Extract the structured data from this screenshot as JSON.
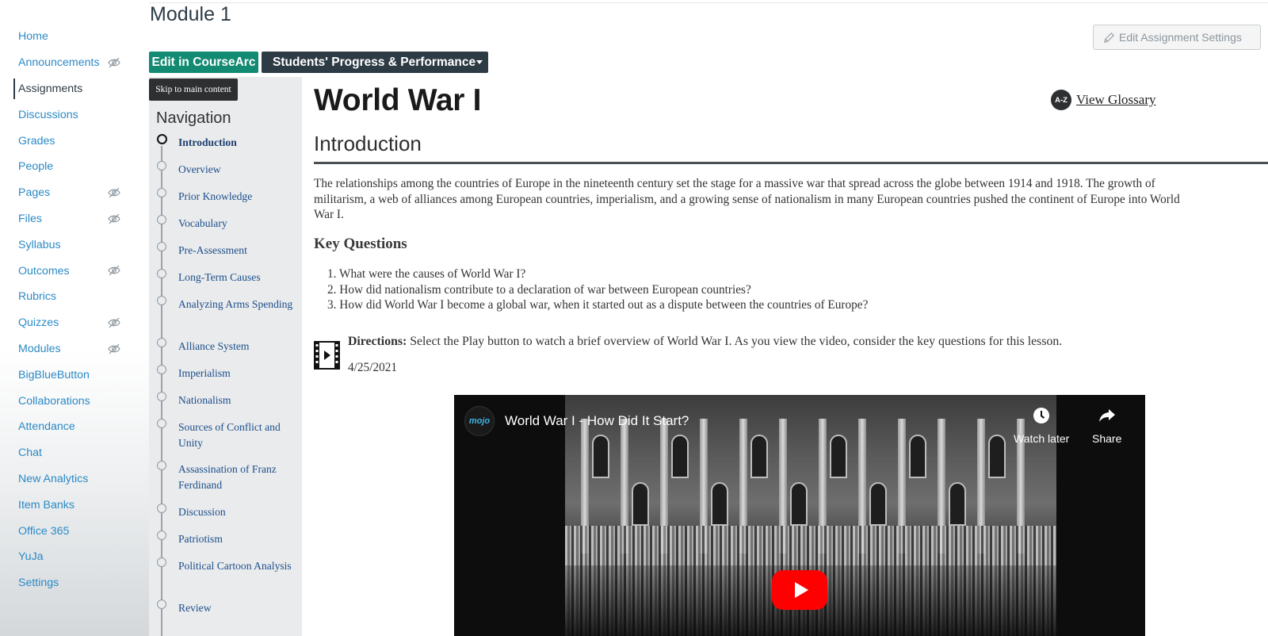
{
  "course_nav": {
    "items": [
      {
        "label": "Home",
        "hidden": false,
        "active": false
      },
      {
        "label": "Announcements",
        "hidden": true,
        "active": false
      },
      {
        "label": "Assignments",
        "hidden": false,
        "active": true
      },
      {
        "label": "Discussions",
        "hidden": false,
        "active": false
      },
      {
        "label": "Grades",
        "hidden": false,
        "active": false
      },
      {
        "label": "People",
        "hidden": false,
        "active": false
      },
      {
        "label": "Pages",
        "hidden": true,
        "active": false
      },
      {
        "label": "Files",
        "hidden": true,
        "active": false
      },
      {
        "label": "Syllabus",
        "hidden": false,
        "active": false
      },
      {
        "label": "Outcomes",
        "hidden": true,
        "active": false
      },
      {
        "label": "Rubrics",
        "hidden": false,
        "active": false
      },
      {
        "label": "Quizzes",
        "hidden": true,
        "active": false
      },
      {
        "label": "Modules",
        "hidden": true,
        "active": false
      },
      {
        "label": "BigBlueButton",
        "hidden": false,
        "active": false
      },
      {
        "label": "Collaborations",
        "hidden": false,
        "active": false
      },
      {
        "label": "Attendance",
        "hidden": false,
        "active": false
      },
      {
        "label": "Chat",
        "hidden": false,
        "active": false
      },
      {
        "label": "New Analytics",
        "hidden": false,
        "active": false
      },
      {
        "label": "Item Banks",
        "hidden": false,
        "active": false
      },
      {
        "label": "Office 365",
        "hidden": false,
        "active": false
      },
      {
        "label": "YuJa",
        "hidden": false,
        "active": false
      },
      {
        "label": "Settings",
        "hidden": false,
        "active": false
      }
    ]
  },
  "header": {
    "module_title": "Module 1",
    "edit_coursearc_label": "Edit in CourseArc",
    "progress_label": "Students' Progress & Performance",
    "edit_settings_label": "Edit Assignment Settings"
  },
  "module_nav": {
    "skip_label": "Skip to main content",
    "heading": "Navigation",
    "steps": [
      {
        "label": "Introduction",
        "current": true
      },
      {
        "label": "Overview",
        "current": false
      },
      {
        "label": "Prior Knowledge",
        "current": false
      },
      {
        "label": "Vocabulary",
        "current": false
      },
      {
        "label": "Pre-Assessment",
        "current": false
      },
      {
        "label": "Long-Term Causes",
        "current": false
      },
      {
        "label": "Analyzing Arms Spending",
        "current": false
      },
      {
        "label": "Alliance System",
        "current": false
      },
      {
        "label": "Imperialism",
        "current": false
      },
      {
        "label": "Nationalism",
        "current": false
      },
      {
        "label": "Sources of Conflict and Unity",
        "current": false
      },
      {
        "label": "Assassination of Franz Ferdinand",
        "current": false
      },
      {
        "label": "Discussion",
        "current": false
      },
      {
        "label": "Patriotism",
        "current": false
      },
      {
        "label": "Political Cartoon Analysis",
        "current": false
      },
      {
        "label": "Review",
        "current": false
      }
    ]
  },
  "content": {
    "title": "World War I",
    "glossary_icon_text": "A-Z",
    "glossary_label": "View Glossary",
    "section_heading": "Introduction",
    "intro_lines": [
      "The relationships among the countries of Europe in the nineteenth century set the stage for a massive war that spread across the globe between 1914 and 1918. The growth of",
      "militarism, a web of alliances among European countries, imperialism, and a growing sense of nationalism in many European countries pushed the continent of Europe into World",
      "War I."
    ],
    "key_questions_heading": "Key Questions",
    "key_questions": [
      "1. What were the causes of World War I?",
      "2. How did nationalism contribute to a declaration of war between European countries?",
      "3. How did World War I become a global war, when it started out as a dispute between the countries of Europe?"
    ],
    "directions_label": "Directions:",
    "directions_text": " Select the Play button to watch a brief overview of World War I. As you view the video, consider the key questions for this lesson.",
    "date": "4/25/2021"
  },
  "video": {
    "channel_logo_text": "mojo",
    "title": "World War I - How Did It Start?",
    "watch_later_label": "Watch later",
    "share_label": "Share"
  },
  "colors": {
    "link": "#2b8ac6",
    "coursearc_green": "#138a72",
    "dark_button": "#2d3b45",
    "youtube_red": "#ff0000"
  }
}
